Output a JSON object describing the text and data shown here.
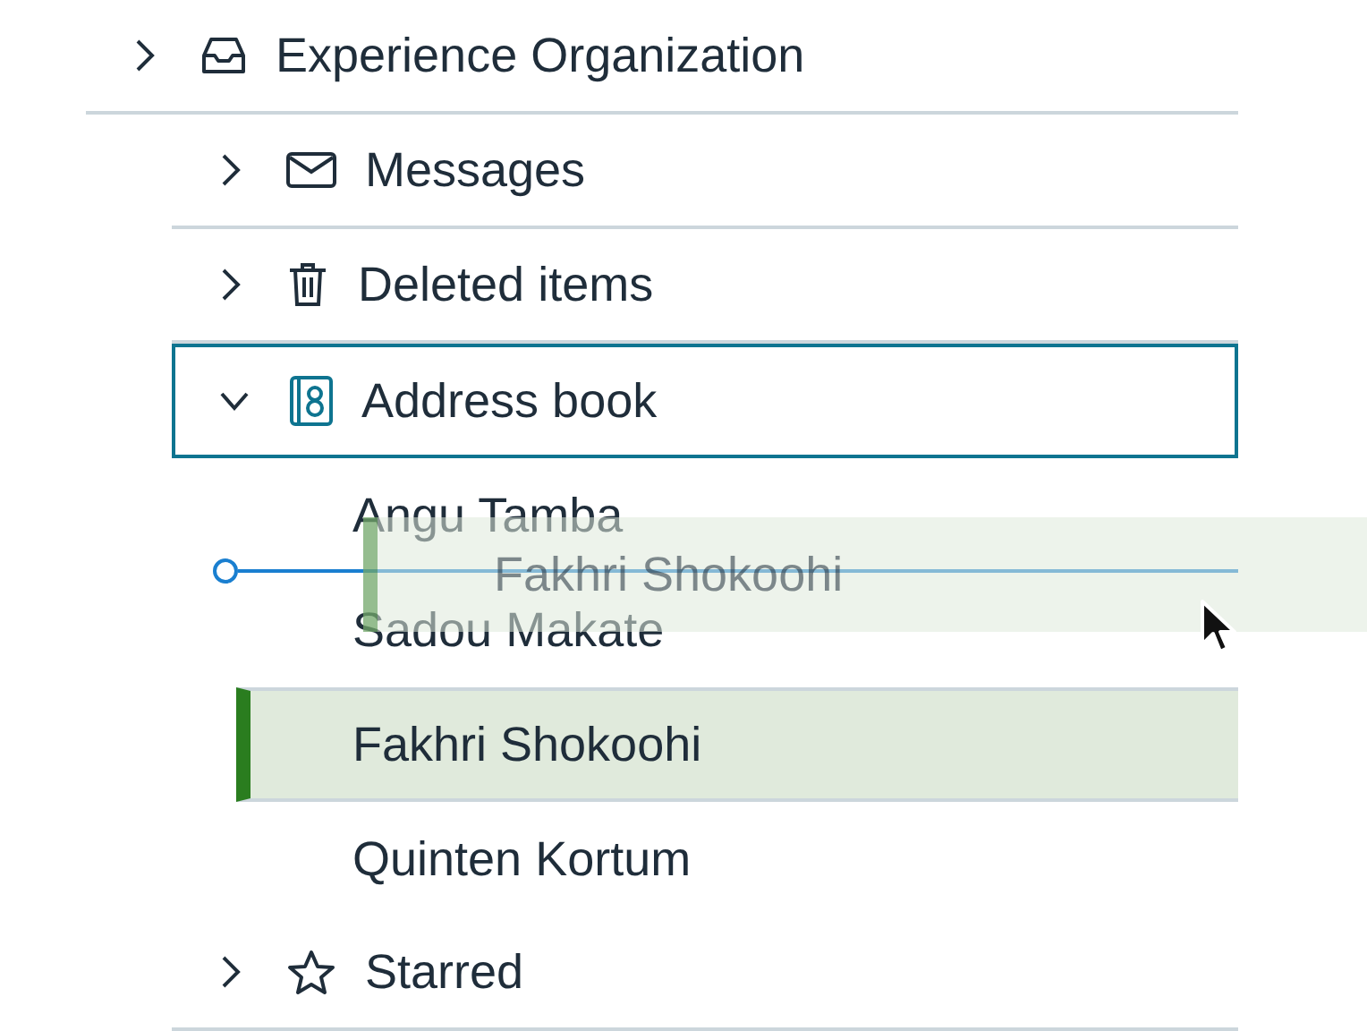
{
  "tree": [
    {
      "label": "Experience Organization",
      "kind": "inbox",
      "expanded": false,
      "children": [
        {
          "label": "Messages",
          "kind": "mail",
          "expanded": false
        },
        {
          "label": "Deleted items",
          "kind": "trash",
          "expanded": false
        },
        {
          "label": "Address book",
          "kind": "contacts",
          "expanded": true,
          "focused": true,
          "children": [
            {
              "label": "Angu Tamba",
              "selected": false
            },
            {
              "label": "Sadou Makate",
              "selected": false
            },
            {
              "label": "Fakhri Shokoohi",
              "selected": true
            },
            {
              "label": "Quinten Kortum",
              "selected": false
            }
          ]
        },
        {
          "label": "Starred",
          "kind": "star",
          "expanded": false
        }
      ]
    }
  ],
  "drag_preview": {
    "label": "Fakhri Shokoohi"
  }
}
